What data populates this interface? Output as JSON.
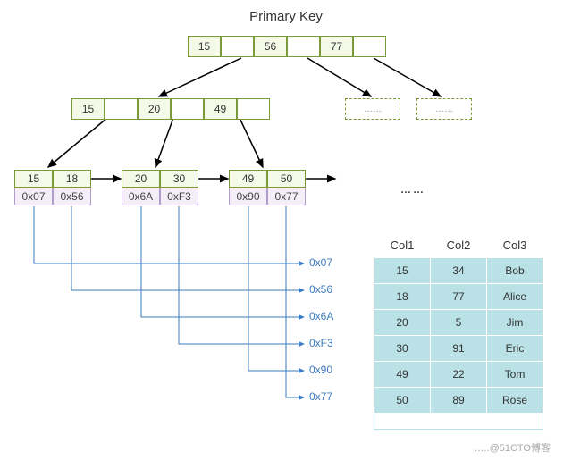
{
  "title": "Primary Key",
  "root_node": {
    "cells": [
      "15",
      "",
      "56",
      "",
      "77",
      ""
    ]
  },
  "internal_node": {
    "cells": [
      "15",
      "",
      "20",
      "",
      "49",
      ""
    ]
  },
  "internal_placeholders": [
    "……",
    "……"
  ],
  "leaf_nodes": [
    {
      "keys": [
        "15",
        "18"
      ],
      "ptrs": [
        "0x07",
        "0x56"
      ]
    },
    {
      "keys": [
        "20",
        "30"
      ],
      "ptrs": [
        "0x6A",
        "0xF3"
      ]
    },
    {
      "keys": [
        "49",
        "50"
      ],
      "ptrs": [
        "0x90",
        "0x77"
      ]
    }
  ],
  "leaf_ellipsis": "……",
  "pointer_labels": [
    "0x07",
    "0x56",
    "0x6A",
    "0xF3",
    "0x90",
    "0x77"
  ],
  "table": {
    "headers": [
      "Col1",
      "Col2",
      "Col3"
    ],
    "rows": [
      [
        "15",
        "34",
        "Bob"
      ],
      [
        "18",
        "77",
        "Alice"
      ],
      [
        "20",
        "5",
        "Jim"
      ],
      [
        "30",
        "91",
        "Eric"
      ],
      [
        "49",
        "22",
        "Tom"
      ],
      [
        "50",
        "89",
        "Rose"
      ]
    ],
    "footer": "…..@51CTO博客"
  },
  "watermark": "…..@51CTO博客"
}
